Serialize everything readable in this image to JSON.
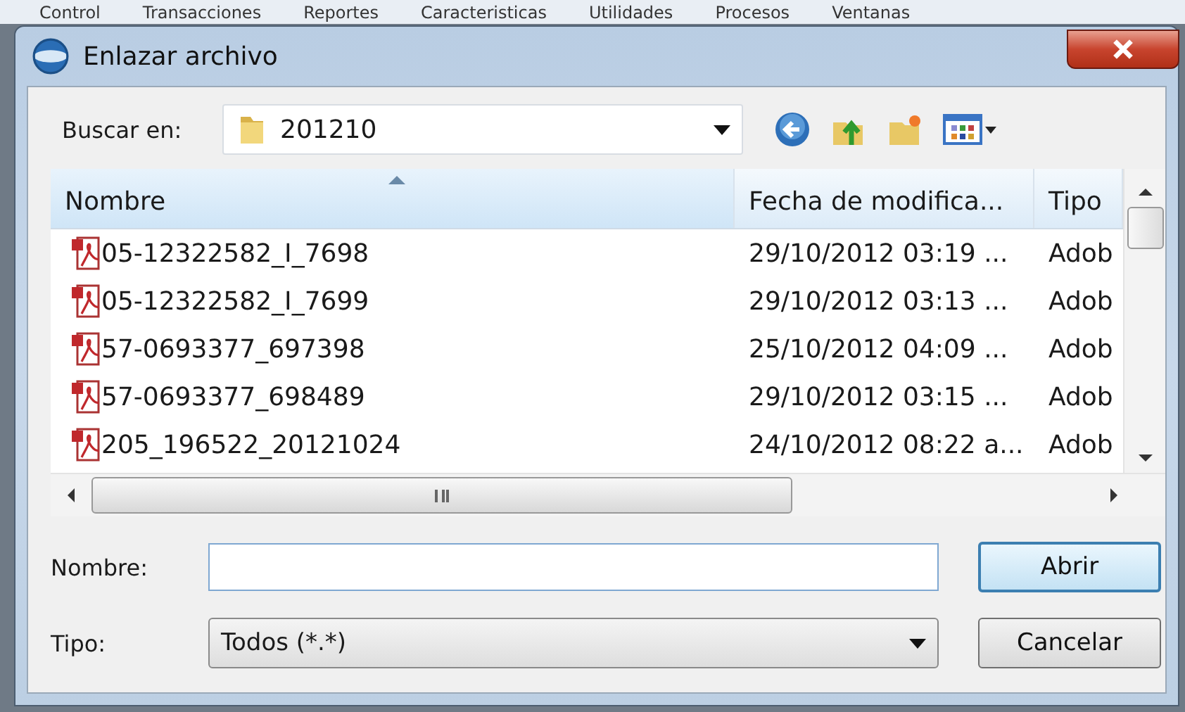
{
  "background_menu": [
    "Control",
    "Transacciones",
    "Reportes",
    "Caracteristicas",
    "Utilidades",
    "Procesos",
    "Ventanas"
  ],
  "window": {
    "title": "Enlazar archivo"
  },
  "look_in": {
    "label": "Buscar en:",
    "value": "201210"
  },
  "file_list": {
    "columns": [
      {
        "label": "Nombre",
        "sorted": true
      },
      {
        "label": "Fecha de modifica...",
        "sorted": false
      },
      {
        "label": "Tipo",
        "sorted": false
      }
    ],
    "rows": [
      {
        "name": "05-12322582_I_7698",
        "date": "29/10/2012 03:19 ...",
        "type": "Adob"
      },
      {
        "name": "05-12322582_I_7699",
        "date": "29/10/2012 03:13 ...",
        "type": "Adob"
      },
      {
        "name": "57-0693377_697398",
        "date": "25/10/2012 04:09 ...",
        "type": "Adob"
      },
      {
        "name": "57-0693377_698489",
        "date": "29/10/2012 03:15 ...",
        "type": "Adob"
      },
      {
        "name": "205_196522_20121024",
        "date": "24/10/2012 08:22 a...",
        "type": "Adob"
      }
    ]
  },
  "file_name": {
    "label": "Nombre:"
  },
  "file_type": {
    "label": "Tipo:",
    "value": "Todos (*.*)"
  },
  "buttons": [
    {
      "label": "Abrir",
      "default": true
    },
    {
      "label": "Cancelar",
      "default": false
    }
  ]
}
